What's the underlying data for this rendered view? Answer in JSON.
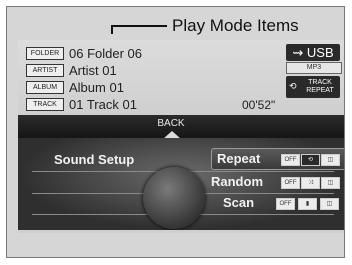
{
  "callout": {
    "label": "Play Mode Items"
  },
  "info": {
    "rows": [
      {
        "tag": "FOLDER",
        "value": "06 Folder 06"
      },
      {
        "tag": "ARTIST",
        "value": "Artist 01"
      },
      {
        "tag": "ALBUM",
        "value": "Album 01"
      },
      {
        "tag": "TRACK",
        "value": "01 Track 01"
      }
    ],
    "time": "00'52\""
  },
  "source": {
    "usb_symbol": "⇝",
    "usb_label": "USB",
    "format": "MP3",
    "track_repeat": "TRACK REPEAT",
    "track_repeat_symbol": "⟲"
  },
  "back": {
    "label": "BACK"
  },
  "menu": {
    "sound_setup": "Sound Setup",
    "options": [
      {
        "label": "Repeat",
        "chips": [
          "OFF",
          "⟲",
          "◫"
        ]
      },
      {
        "label": "Random",
        "chips": [
          "OFF",
          "⤨",
          "◫"
        ]
      },
      {
        "label": "Scan",
        "chips": [
          "OFF",
          "▮",
          "◫"
        ]
      }
    ]
  }
}
